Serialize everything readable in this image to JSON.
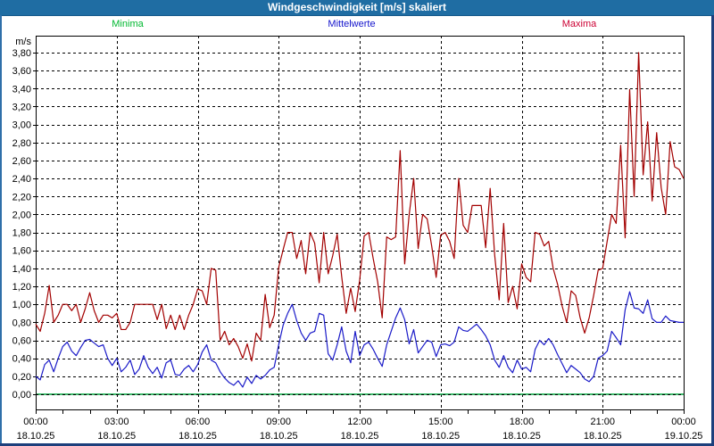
{
  "window": {
    "title": "Windgeschwindigkeit [m/s] skaliert"
  },
  "colors": {
    "title_bar": "#1f6da3",
    "title_text": "#ffffff",
    "border_light": "#2f6fa9",
    "border_dark": "#1d3f7c",
    "frame": "#000000",
    "grid": "#000000",
    "plot_background": "#ffffff"
  },
  "chart_data": {
    "type": "line",
    "title": "Windgeschwindigkeit [m/s] skaliert",
    "y_unit_label": "m/s",
    "ylabel": "",
    "xlabel": "",
    "ylim": [
      0.0,
      3.8
    ],
    "y_tick_step": 0.2,
    "y_tick_labels": [
      "0,00",
      "0,20",
      "0,40",
      "0,60",
      "0,80",
      "1,00",
      "1,20",
      "1,40",
      "1,60",
      "1,80",
      "2,00",
      "2,20",
      "2,40",
      "2,60",
      "2,80",
      "3,00",
      "3,20",
      "3,40",
      "3,60",
      "3,80"
    ],
    "grid": "dashed",
    "legend_position": "top",
    "x_axis": {
      "start_hour": 0,
      "end_hour": 24,
      "major_tick_hours": 3,
      "minor_tick_hours": 1,
      "tick_labels": [
        {
          "time": "00:00",
          "date": "18.10.25"
        },
        {
          "time": "03:00",
          "date": "18.10.25"
        },
        {
          "time": "06:00",
          "date": "18.10.25"
        },
        {
          "time": "09:00",
          "date": "18.10.25"
        },
        {
          "time": "12:00",
          "date": "18.10.25"
        },
        {
          "time": "15:00",
          "date": "18.10.25"
        },
        {
          "time": "18:00",
          "date": "18.10.25"
        },
        {
          "time": "21:00",
          "date": "18.10.25"
        },
        {
          "time": "00:00",
          "date": "19.10.25"
        }
      ]
    },
    "sample_interval_minutes": 10,
    "series": [
      {
        "name": "Minima",
        "legend_color": "#00b830",
        "line_color": "#00a33c",
        "constant": 0.0
      },
      {
        "name": "Mittelwerte",
        "legend_color": "#1414cc",
        "line_color": "#1a1ac8",
        "values": [
          0.2,
          0.16,
          0.33,
          0.38,
          0.25,
          0.4,
          0.53,
          0.58,
          0.48,
          0.43,
          0.52,
          0.6,
          0.61,
          0.57,
          0.53,
          0.55,
          0.4,
          0.32,
          0.4,
          0.25,
          0.3,
          0.38,
          0.22,
          0.28,
          0.43,
          0.3,
          0.23,
          0.3,
          0.18,
          0.35,
          0.38,
          0.22,
          0.21,
          0.28,
          0.32,
          0.25,
          0.33,
          0.47,
          0.55,
          0.38,
          0.35,
          0.25,
          0.18,
          0.13,
          0.1,
          0.15,
          0.08,
          0.19,
          0.12,
          0.21,
          0.17,
          0.21,
          0.27,
          0.3,
          0.55,
          0.77,
          0.9,
          1.0,
          0.82,
          0.68,
          0.6,
          0.68,
          0.7,
          0.9,
          0.88,
          0.45,
          0.38,
          0.55,
          0.75,
          0.48,
          0.35,
          0.7,
          0.43,
          0.55,
          0.58,
          0.5,
          0.4,
          0.31,
          0.55,
          0.7,
          0.85,
          0.96,
          0.83,
          0.56,
          0.72,
          0.46,
          0.53,
          0.6,
          0.58,
          0.42,
          0.55,
          0.56,
          0.54,
          0.58,
          0.75,
          0.71,
          0.7,
          0.74,
          0.78,
          0.72,
          0.65,
          0.55,
          0.38,
          0.3,
          0.43,
          0.3,
          0.24,
          0.38,
          0.28,
          0.3,
          0.25,
          0.5,
          0.6,
          0.55,
          0.62,
          0.55,
          0.44,
          0.34,
          0.24,
          0.32,
          0.28,
          0.24,
          0.17,
          0.14,
          0.2,
          0.4,
          0.43,
          0.48,
          0.7,
          0.63,
          0.55,
          0.94,
          1.14,
          0.96,
          0.95,
          0.9,
          1.05,
          0.84,
          0.8,
          0.8,
          0.87,
          0.82,
          0.81,
          0.8,
          0.8
        ]
      },
      {
        "name": "Maxima",
        "legend_color": "#cc0033",
        "line_color": "#a30000",
        "values": [
          0.78,
          0.7,
          0.9,
          1.21,
          0.8,
          0.88,
          1.0,
          1.0,
          0.93,
          1.0,
          0.8,
          0.95,
          1.13,
          0.93,
          0.8,
          0.88,
          0.88,
          0.85,
          0.9,
          0.72,
          0.72,
          0.8,
          1.0,
          1.0,
          1.0,
          1.0,
          1.0,
          0.83,
          1.0,
          0.73,
          0.88,
          0.72,
          0.88,
          0.72,
          0.88,
          1.0,
          1.17,
          1.15,
          1.0,
          1.4,
          1.38,
          0.6,
          0.7,
          0.55,
          0.62,
          0.53,
          0.4,
          0.56,
          0.37,
          0.68,
          0.6,
          1.11,
          0.74,
          0.88,
          1.41,
          1.61,
          1.8,
          1.8,
          1.51,
          1.71,
          1.34,
          1.8,
          1.68,
          1.24,
          1.8,
          1.34,
          1.54,
          1.78,
          1.31,
          0.9,
          1.18,
          0.92,
          1.27,
          1.76,
          1.8,
          1.51,
          1.25,
          0.85,
          1.75,
          1.72,
          1.75,
          2.71,
          1.45,
          2.0,
          2.4,
          1.62,
          2.0,
          1.95,
          1.65,
          1.3,
          1.77,
          1.8,
          1.7,
          1.51,
          2.4,
          1.88,
          1.8,
          2.1,
          2.1,
          2.1,
          1.63,
          2.29,
          1.55,
          1.05,
          1.9,
          1.02,
          1.2,
          0.95,
          1.45,
          1.3,
          1.25,
          1.8,
          1.78,
          1.65,
          1.7,
          1.4,
          1.22,
          0.98,
          0.8,
          1.15,
          1.1,
          0.85,
          0.68,
          0.85,
          1.1,
          1.38,
          1.4,
          1.7,
          2.0,
          1.9,
          2.77,
          1.74,
          3.39,
          2.2,
          3.8,
          2.44,
          3.03,
          2.15,
          2.91,
          2.3,
          2.0,
          2.81,
          2.53,
          2.5,
          2.4
        ]
      }
    ]
  }
}
